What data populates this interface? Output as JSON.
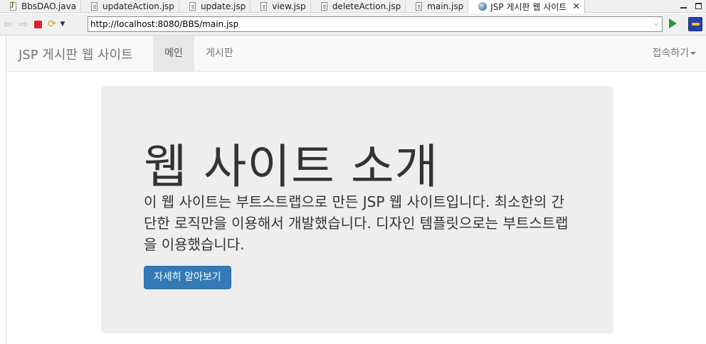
{
  "tabs": [
    {
      "label": "BbsDAO.java",
      "icon": "java-file-icon"
    },
    {
      "label": "updateAction.jsp",
      "icon": "jsp-file-icon"
    },
    {
      "label": "update.jsp",
      "icon": "jsp-file-icon"
    },
    {
      "label": "view.jsp",
      "icon": "jsp-file-icon"
    },
    {
      "label": "deleteAction.jsp",
      "icon": "jsp-file-icon"
    },
    {
      "label": "main.jsp",
      "icon": "jsp-file-icon"
    },
    {
      "label": "JSP 게시판 웹 사이트",
      "icon": "globe-icon",
      "active": true
    }
  ],
  "address": {
    "url": "http://localhost:8080/BBS/main.jsp"
  },
  "navbar": {
    "brand": "JSP 게시판 웹 사이트",
    "items": [
      {
        "label": "메인",
        "active": true
      },
      {
        "label": "게시판",
        "active": false
      }
    ],
    "dropdown": "접속하기"
  },
  "jumbotron": {
    "title": "웹 사이트 소개",
    "description": "이 웹 사이트는 부트스트랩으로 만든 JSP 웹 사이트입니다. 최소한의 간단한 로직만을 이용해서 개발했습니다. 디자인 템플릿으로는 부트스트랩을 이용했습니다.",
    "button": "자세히 알아보기"
  },
  "colors": {
    "primary_button": "#337ab7",
    "jumbotron_bg": "#eeeeee",
    "navbar_bg": "#f8f8f8"
  }
}
